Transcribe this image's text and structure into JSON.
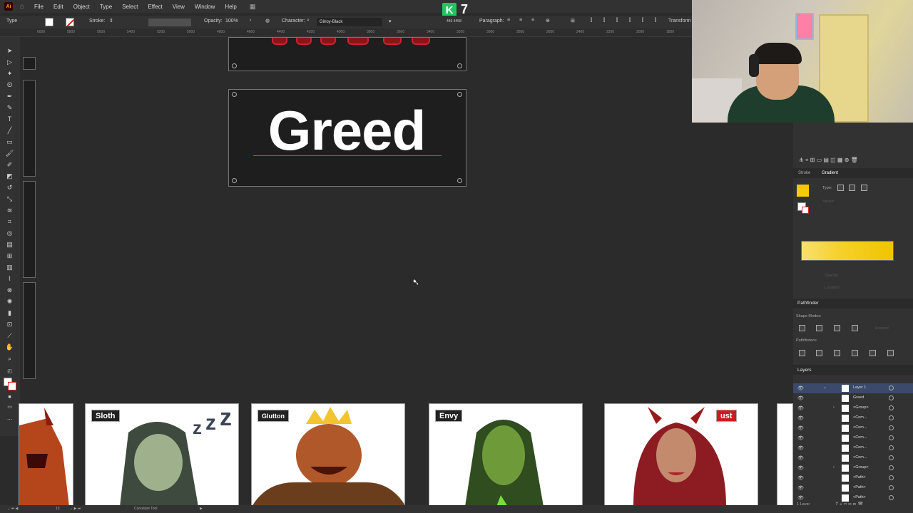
{
  "app": {
    "logo": "Ai"
  },
  "menu": [
    "File",
    "Edit",
    "Object",
    "Type",
    "Select",
    "Effect",
    "View",
    "Window",
    "Help"
  ],
  "overlay": {
    "k_letter": "K",
    "count": "7"
  },
  "control": {
    "mode": "Type",
    "stroke_label": "Stroke:",
    "opacity_label": "Opacity:",
    "opacity_value": "100%",
    "character_label": "Character:",
    "font": "Gilroy-Black",
    "coords": "446.4458",
    "paragraph_label": "Paragraph:",
    "transform_label": "Transform"
  },
  "ruler_ticks": [
    "6000",
    "5800",
    "5600",
    "5400",
    "5200",
    "5000",
    "4800",
    "4600",
    "4400",
    "4200",
    "4000",
    "3800",
    "3600",
    "3400",
    "3200",
    "3000",
    "2800",
    "2600",
    "2400",
    "2200",
    "2000",
    "1800"
  ],
  "canvas": {
    "artboard_text": "Greed"
  },
  "panels": {
    "stroke_tab": "Stroke",
    "gradient_tab": "Gradient",
    "type_label": "Type:",
    "stroke_row_label": "Stroke:",
    "opacity_label": "Opacity:",
    "location_label": "Location:",
    "pathfinder_title": "Pathfinder",
    "shape_modes_label": "Shape Modes:",
    "expand_label": "Expand",
    "pathfinders_label": "Pathfinders:",
    "layers_title": "Layers",
    "layers_count": "1 Layer"
  },
  "layers": [
    {
      "name": "Layer 1"
    },
    {
      "name": "Greed"
    },
    {
      "name": "<Group>"
    },
    {
      "name": "<Com..."
    },
    {
      "name": "<Com..."
    },
    {
      "name": "<Com..."
    },
    {
      "name": "<Com..."
    },
    {
      "name": "<Com..."
    },
    {
      "name": "<Group>"
    },
    {
      "name": "<Path>"
    },
    {
      "name": "<Path>"
    },
    {
      "name": "<Path>"
    }
  ],
  "cards": [
    {
      "label": ""
    },
    {
      "label": "Sloth"
    },
    {
      "label": "Glutton"
    },
    {
      "label": "Envy"
    },
    {
      "label": "ust"
    }
  ],
  "status": {
    "zoom": "13",
    "tool": "Curvature Tool"
  }
}
